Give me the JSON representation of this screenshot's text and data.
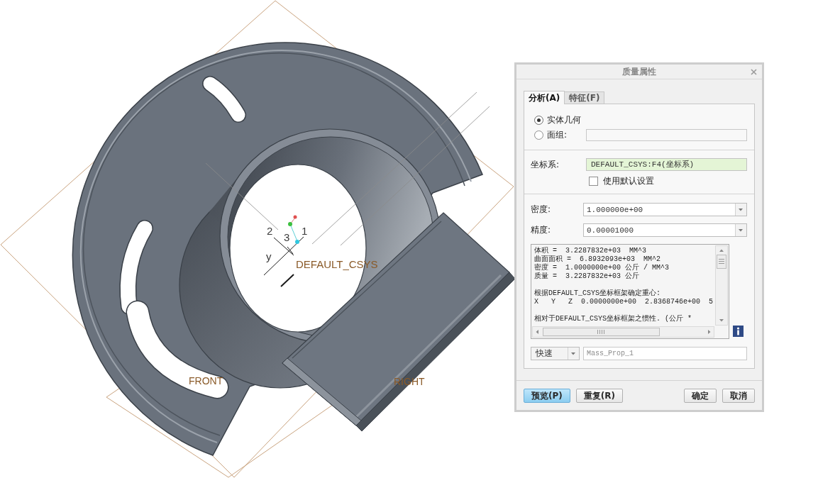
{
  "viewport": {
    "plane_labels": [
      "FRONT",
      "RIGHT"
    ],
    "csys_label": "DEFAULT_CSYS",
    "axis_labels": [
      "2",
      "3",
      "1",
      "y"
    ]
  },
  "dialog": {
    "title": "质量属性",
    "tabs": [
      {
        "label": "分析(A)",
        "selected": true
      },
      {
        "label": "特征(F)",
        "selected": false
      }
    ],
    "geometry": [
      {
        "label": "实体几何",
        "selected": true,
        "kind": "plain"
      },
      {
        "label": "面组:",
        "selected": false,
        "kind": "with_field"
      }
    ],
    "csys": {
      "label": "坐标系:",
      "value": "DEFAULT_CSYS:F4(坐标系)"
    },
    "use_default": {
      "label": "使用默认设置",
      "checked": false
    },
    "density": {
      "label": "密度:",
      "value": "1.000000e+00"
    },
    "precision": {
      "label": "精度:",
      "value": "0.00001000"
    },
    "results": [
      {
        "lines": [
          "体积 =  3.2287832e+03  MM^3",
          "曲面面积 =  6.8932093e+03  MM^2",
          "密度 =  1.0000000e+00 公斤 / MM^3",
          "质量 =  3.2287832e+03 公斤"
        ]
      },
      {
        "lines": [
          "根据DEFAULT_CSYS坐标框架确定重心:",
          "X   Y   Z  0.0000000e+00  2.8368746e+00  5"
        ]
      },
      {
        "lines": [
          "相对于DEFAULT_CSYS坐标框架之惯性. (公斤 *"
        ]
      }
    ],
    "mode": {
      "value": "快速"
    },
    "name_field": {
      "value": "Mass_Prop_1",
      "disabled": true
    },
    "footer": {
      "left": [
        {
          "label": "预览(P)",
          "primary": true
        },
        {
          "label": "重复(R)",
          "primary": false
        }
      ],
      "right": [
        {
          "label": "确定",
          "primary": false
        },
        {
          "label": "取消",
          "primary": false
        }
      ]
    }
  }
}
